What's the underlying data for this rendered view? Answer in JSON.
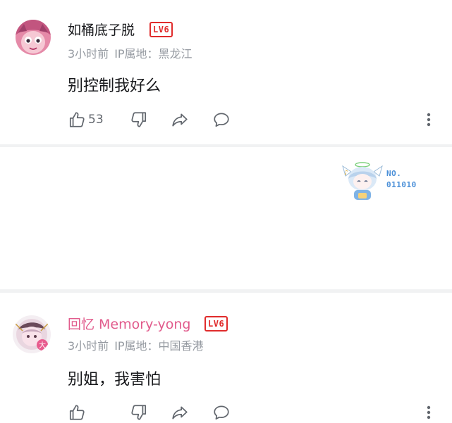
{
  "comments": [
    {
      "username": "如桶底子脱",
      "level": "LV6",
      "time": "3小时前",
      "location": "IP属地：黑龙江",
      "content": "别控制我好么",
      "likes": "53",
      "username_color": "#18191c"
    },
    {
      "username": "回忆 Memory-yong",
      "level": "LV6",
      "time": "3小时前",
      "location": "IP属地：中国香港",
      "content": "别姐，我害怕",
      "likes": "",
      "username_color": "#e15b8c",
      "decoration": {
        "line1": "NO.",
        "line2": "011010"
      }
    }
  ],
  "icons": {
    "like": "thumbs-up-icon",
    "dislike": "thumbs-down-icon",
    "share": "share-icon",
    "reply": "reply-bubble-icon",
    "more": "more-vertical-icon"
  },
  "colors": {
    "level_badge": "#e02b2b",
    "meta_text": "#9499a0",
    "icon": "#61666d",
    "divider": "#f1f2f3"
  }
}
